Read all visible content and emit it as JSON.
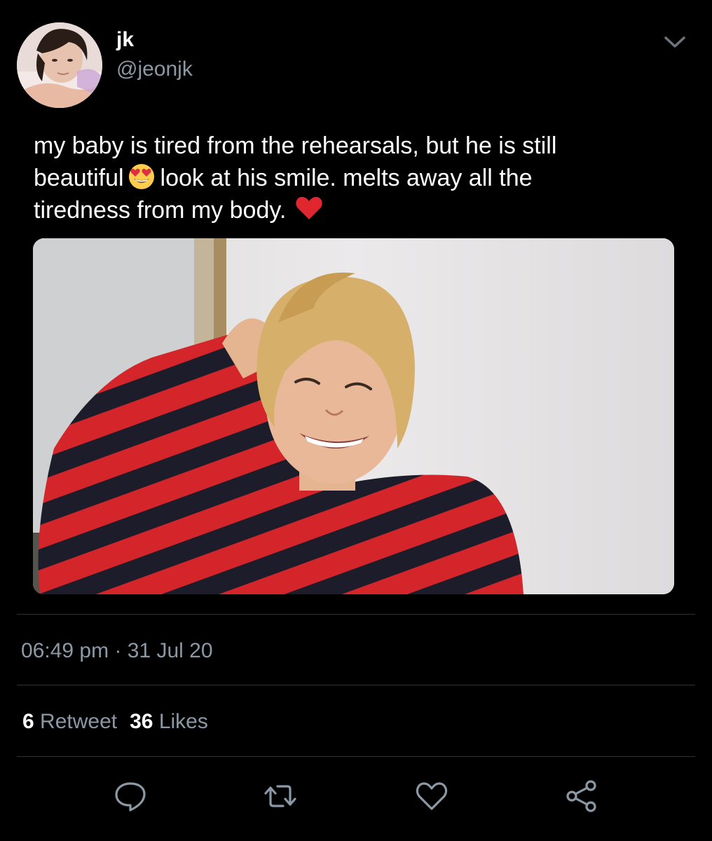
{
  "user": {
    "display_name": "jk",
    "handle": "@jeonjk"
  },
  "tweet": {
    "line1": "my baby is tired from the rehearsals, but he is still",
    "line2_a": "beautiful",
    "line2_b": "look at his smile. melts away all the",
    "line3": "tiredness from my body.",
    "emoji_1": "smiling-face-with-heart-eyes",
    "emoji_2": "red-heart"
  },
  "meta": {
    "time": "06:49 pm",
    "separator": "·",
    "date": "31 Jul 20"
  },
  "stats": {
    "retweet_count": "6",
    "retweet_label": "Retweet",
    "like_count": "36",
    "like_label": "Likes"
  },
  "actions": [
    "reply-icon",
    "retweet-icon",
    "like-icon",
    "share-icon"
  ],
  "colors": {
    "background": "#000000",
    "primary_text": "#ffffff",
    "secondary_text": "#8b98a5",
    "divider": "#2f3336",
    "icon": "#8b98a5",
    "heart_emoji": "#e0262f"
  }
}
